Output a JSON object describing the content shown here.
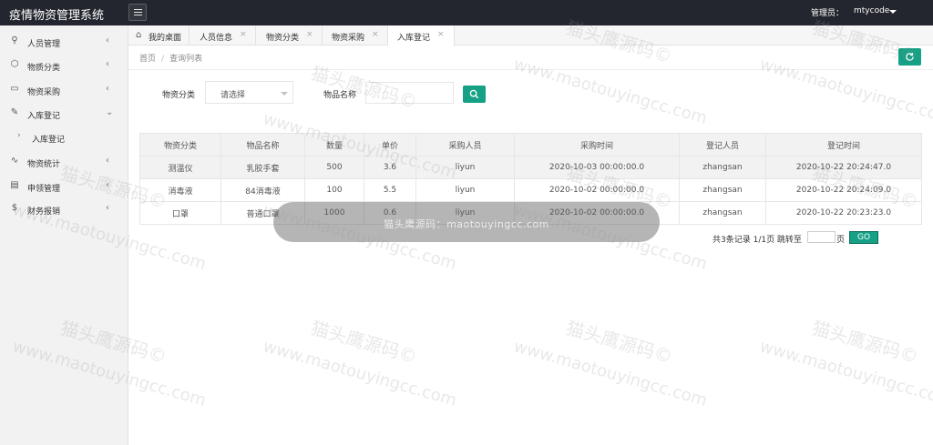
{
  "app": {
    "title": "疫情物资管理系统",
    "admin_label": "管理员：",
    "username": "mtycode"
  },
  "colors": {
    "header_bg": "#23262e",
    "accent": "#16a085",
    "sidebar_bg": "#f2f2f2"
  },
  "sidebar": {
    "items": [
      {
        "label": "人员管理",
        "icon": "user-icon",
        "glyph": "⚲",
        "arrow": "‹"
      },
      {
        "label": "物质分类",
        "icon": "cube-icon",
        "glyph": "⬡",
        "arrow": "‹"
      },
      {
        "label": "物资采购",
        "icon": "truck-icon",
        "glyph": "▭",
        "arrow": "‹"
      },
      {
        "label": "入库登记",
        "icon": "edit-icon",
        "glyph": "✎",
        "arrow": "⌄"
      },
      {
        "label": "物资统计",
        "icon": "pulse-icon",
        "glyph": "∿",
        "arrow": "‹"
      },
      {
        "label": "申领管理",
        "icon": "table-icon",
        "glyph": "▤",
        "arrow": "‹"
      },
      {
        "label": "财务报销",
        "icon": "dollar-icon",
        "glyph": "$",
        "arrow": "‹"
      }
    ],
    "submenu": {
      "label": "入库登记",
      "arrow": "›"
    }
  },
  "tabs": [
    {
      "label": "我的桌面",
      "icon": "home-icon",
      "glyph": "⌂"
    },
    {
      "label": "人员信息",
      "close": "×"
    },
    {
      "label": "物资分类",
      "close": "×"
    },
    {
      "label": "物资采购",
      "close": "×"
    },
    {
      "label": "入库登记",
      "close": "×"
    }
  ],
  "breadcrumb": {
    "home": "首页",
    "sep": "/",
    "current": "查询列表"
  },
  "filter": {
    "category_label": "物资分类",
    "category_value": "请选择",
    "name_label": "物品名称",
    "name_value": ""
  },
  "table": {
    "headers": [
      "物资分类",
      "物品名称",
      "数量",
      "单价",
      "采购人员",
      "采购时间",
      "登记人员",
      "登记时间"
    ],
    "rows": [
      [
        "测温仪",
        "乳胶手套",
        "500",
        "3.6",
        "liyun",
        "2020-10-03 00:00:00.0",
        "zhangsan",
        "2020-10-22 20:24:47.0"
      ],
      [
        "消毒液",
        "84消毒液",
        "100",
        "5.5",
        "liyun",
        "2020-10-02 00:00:00.0",
        "zhangsan",
        "2020-10-22 20:24:09.0"
      ],
      [
        "口罩",
        "普通口罩",
        "1000",
        "0.6",
        "liyun",
        "2020-10-02 00:00:00.0",
        "zhangsan",
        "2020-10-22 20:23:23.0"
      ]
    ]
  },
  "pager": {
    "summary": "共3条记录  1/1页  跳转至",
    "page_unit": "页",
    "go_label": "GO"
  },
  "toast": {
    "text": "猫头鹰源码：maotouyingcc.com"
  },
  "watermark": {
    "site": "www.maotouyingcc.com",
    "cn": "猫头鹰源码©"
  }
}
